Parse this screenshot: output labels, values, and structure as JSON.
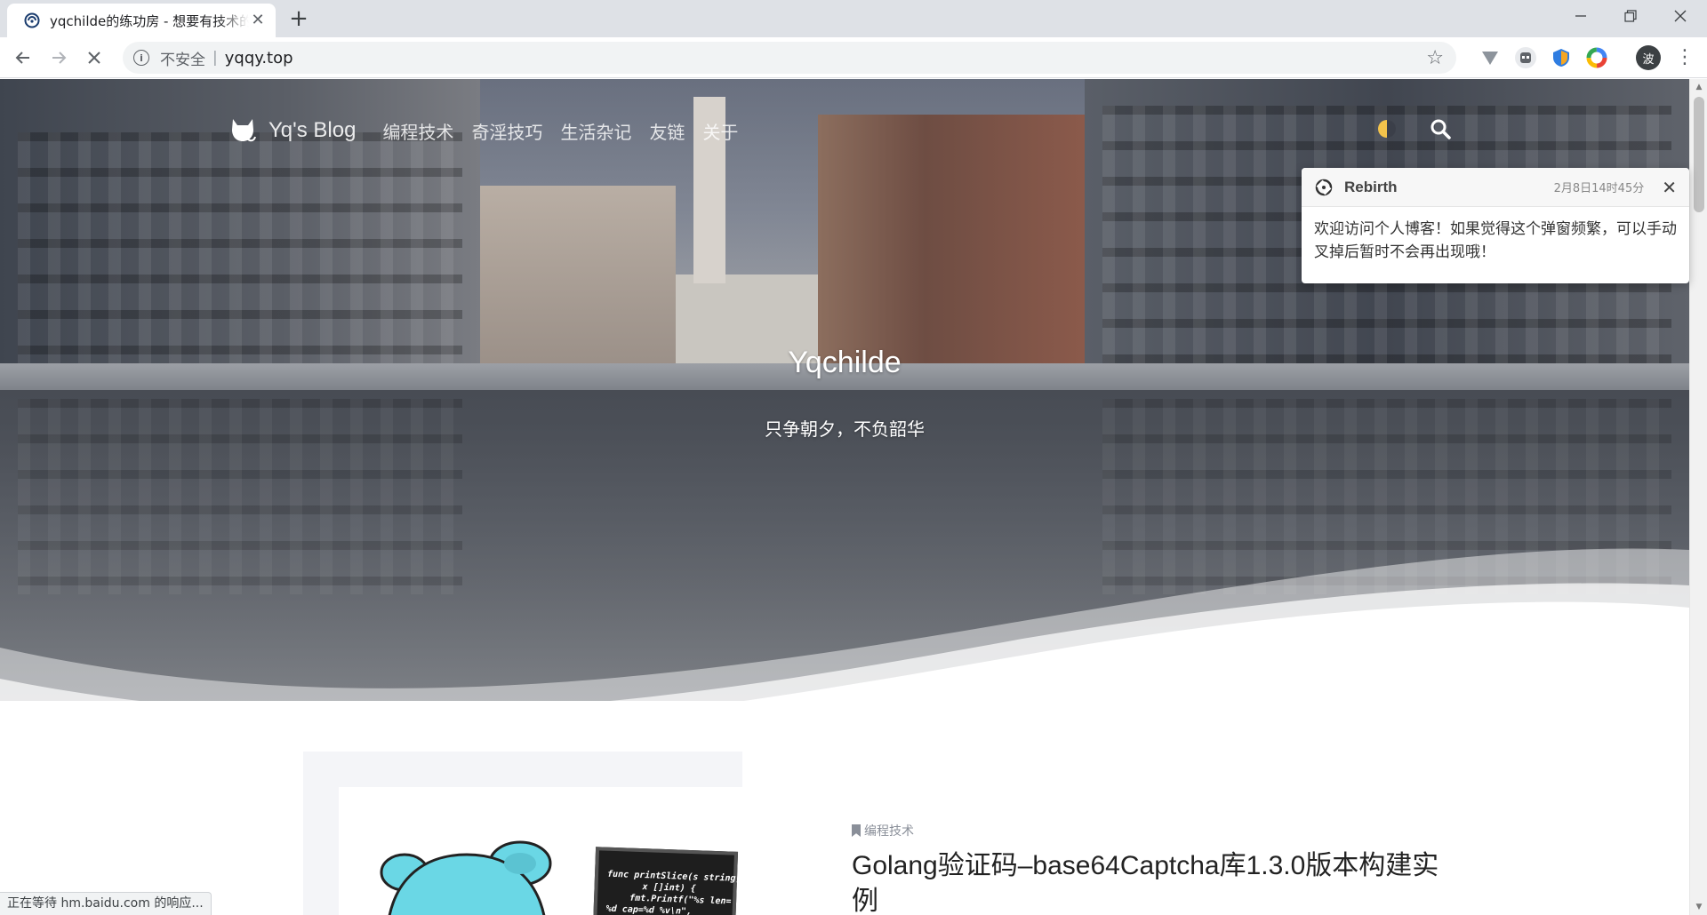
{
  "browser": {
    "tab_title": "yqchilde的练功房 - 想要有技术的",
    "tab_close": "✕",
    "new_tab": "+",
    "address": {
      "security_label": "不安全",
      "separator": "|",
      "url": "yqqy.top"
    },
    "profile_initial": "波",
    "status_text": "正在等待 hm.baidu.com 的响应..."
  },
  "site": {
    "name": "Yq's Blog",
    "nav": [
      "编程技术",
      "奇淫技巧",
      "生活杂记",
      "友链",
      "关于"
    ],
    "hero_title": "Yqchilde",
    "hero_subtitle": "只争朝夕，不负韶华"
  },
  "post": {
    "category": "编程技术",
    "title": "Golang验证码–base64Captcha库1.3.0版本构建实例",
    "image_code": [
      "func printSlice(s string,",
      "x []int) {",
      "fmt.Printf(\"%s len=",
      "%d cap=%d %v\\n\","
    ]
  },
  "notification": {
    "name": "Rebirth",
    "time": "2月8日14时45分",
    "close": "✕",
    "message": "欢迎访问个人博客！如果觉得这个弹窗频繁，可以手动叉掉后暂时不会再出现哦！"
  },
  "colors": {
    "chrome_bg": "#dee1e6",
    "omnibox_bg": "#f1f3f4",
    "text_dark": "#202124",
    "category_gray": "#8a8f99"
  }
}
